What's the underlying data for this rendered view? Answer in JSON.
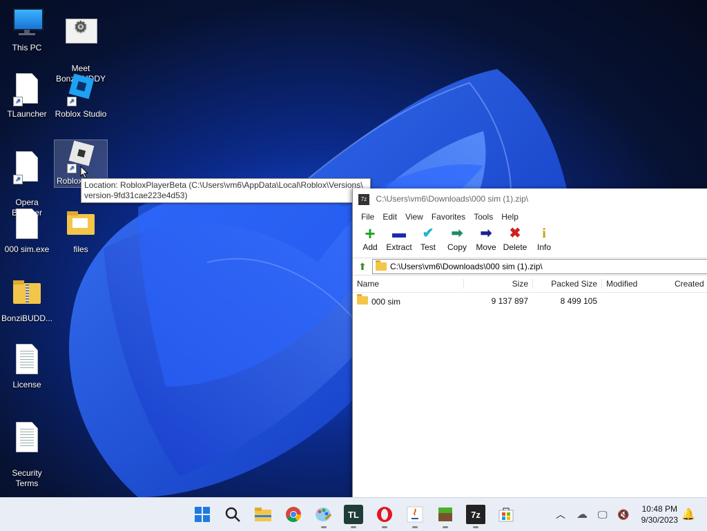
{
  "desktop": {
    "icons": [
      {
        "label": "This PC",
        "icon": "monitor-icon"
      },
      {
        "label": "Meet\nBonziBUDDY",
        "icon": "settings-app-icon"
      },
      {
        "label": "TLauncher",
        "icon": "file-icon"
      },
      {
        "label": "Roblox Studio",
        "icon": "roblox-studio-icon"
      },
      {
        "label": "Opera\nBrowser",
        "icon": "file-icon"
      },
      {
        "label": "Roblox",
        "icon": "roblox-player-icon"
      },
      {
        "label": "000 sim.exe",
        "icon": "file-icon"
      },
      {
        "label": "files",
        "icon": "folder-icon"
      },
      {
        "label": "BonziBUDD...",
        "icon": "zip-folder-icon"
      },
      {
        "label": "License",
        "icon": "text-file-icon"
      },
      {
        "label": "Security\nTerms",
        "icon": "text-file-icon"
      }
    ],
    "tooltip": {
      "line1": "Location: RobloxPlayerBeta (C:\\Users\\vm6\\AppData\\Local\\Roblox\\Versions\\",
      "line2": "version-9fd31cae223e4d53)"
    }
  },
  "sevenzip": {
    "title": "C:\\Users\\vm6\\Downloads\\000 sim (1).zip\\",
    "menu": [
      "File",
      "Edit",
      "View",
      "Favorites",
      "Tools",
      "Help"
    ],
    "toolbar": [
      {
        "label": "Add",
        "icon": "plus-icon",
        "glyph": "+",
        "color": "#1aa51a"
      },
      {
        "label": "Extract",
        "icon": "minus-icon",
        "glyph": "▬",
        "color": "#1b2bb0"
      },
      {
        "label": "Test",
        "icon": "check-icon",
        "glyph": "✔",
        "color": "#18b6c9"
      },
      {
        "label": "Copy",
        "icon": "copy-arrow-icon",
        "glyph": "➡",
        "color": "#1f8a6a"
      },
      {
        "label": "Move",
        "icon": "move-arrow-icon",
        "glyph": "➡",
        "color": "#1b2290"
      },
      {
        "label": "Delete",
        "icon": "delete-x-icon",
        "glyph": "✖",
        "color": "#d01f1f"
      },
      {
        "label": "Info",
        "icon": "info-icon",
        "glyph": "i",
        "color": "#c9a400"
      }
    ],
    "address": "C:\\Users\\vm6\\Downloads\\000 sim (1).zip\\",
    "columns": {
      "name": "Name",
      "size": "Size",
      "packed": "Packed Size",
      "modified": "Modified",
      "created": "Created"
    },
    "rows": [
      {
        "name": "000 sim",
        "size": "9 137 897",
        "packed": "8 499 105",
        "modified": "",
        "created": ""
      }
    ]
  },
  "taskbar": {
    "apps": [
      "start-icon",
      "search-icon",
      "file-explorer-icon",
      "chrome-icon",
      "paint-icon",
      "tlauncher-icon",
      "opera-icon",
      "java-icon",
      "minecraft-icon",
      "7zip-icon",
      "store-icon"
    ],
    "tl_label": "TL",
    "sevenzip_label": "7z",
    "time": "10:48 PM",
    "date": "9/30/2023"
  }
}
